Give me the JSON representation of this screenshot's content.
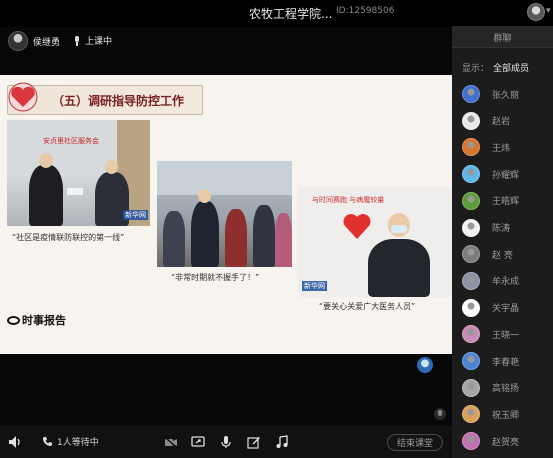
{
  "window": {
    "title": "农牧工程学院...",
    "room_id": "ID:12598506"
  },
  "host": {
    "name": "侯继勇",
    "class_state": "上课中"
  },
  "slide": {
    "heading": "（五）调研指导防控工作",
    "photos": [
      {
        "sign": "安贞里社区服务会",
        "label": "新华网"
      },
      {
        "sign": "",
        "label": ""
      },
      {
        "sign": "与时间赛跑 与病魔较量",
        "label": "新华网"
      }
    ],
    "captions": [
      "“社区是疫情联防联控的第一线”",
      "“非常时期就不握手了！”",
      "“要关心关爱广大医务人员”"
    ],
    "logo": "时事报告"
  },
  "toolbar": {
    "waiting_text": "1人等待中",
    "end_button": "结束课堂"
  },
  "panel": {
    "tab": "群聊",
    "filter_label": "显示：",
    "filter_value": "全部成员",
    "members": [
      {
        "name": "张久丽",
        "color": "#3f6fd1"
      },
      {
        "name": "赵岩",
        "color": "#e9e9e9"
      },
      {
        "name": "王炜",
        "color": "#d9742b"
      },
      {
        "name": "孙耀辉",
        "color": "#5fb6e8"
      },
      {
        "name": "王皓辉",
        "color": "#5d9c3a"
      },
      {
        "name": "陈涛",
        "color": "#f2f2f2"
      },
      {
        "name": "赵 亮",
        "color": "#7c7c7c"
      },
      {
        "name": "牟永成",
        "color": "#8b94a6"
      },
      {
        "name": "关宇晶",
        "color": "#ffffff"
      },
      {
        "name": "王晓一",
        "color": "#c88ab6"
      },
      {
        "name": "李春艳",
        "color": "#4b86d6"
      },
      {
        "name": "高铭扬",
        "color": "#a6a6a6"
      },
      {
        "name": "祝玉卿",
        "color": "#d9a15a"
      },
      {
        "name": "赵贺亮",
        "color": "#c46fb0"
      }
    ]
  }
}
